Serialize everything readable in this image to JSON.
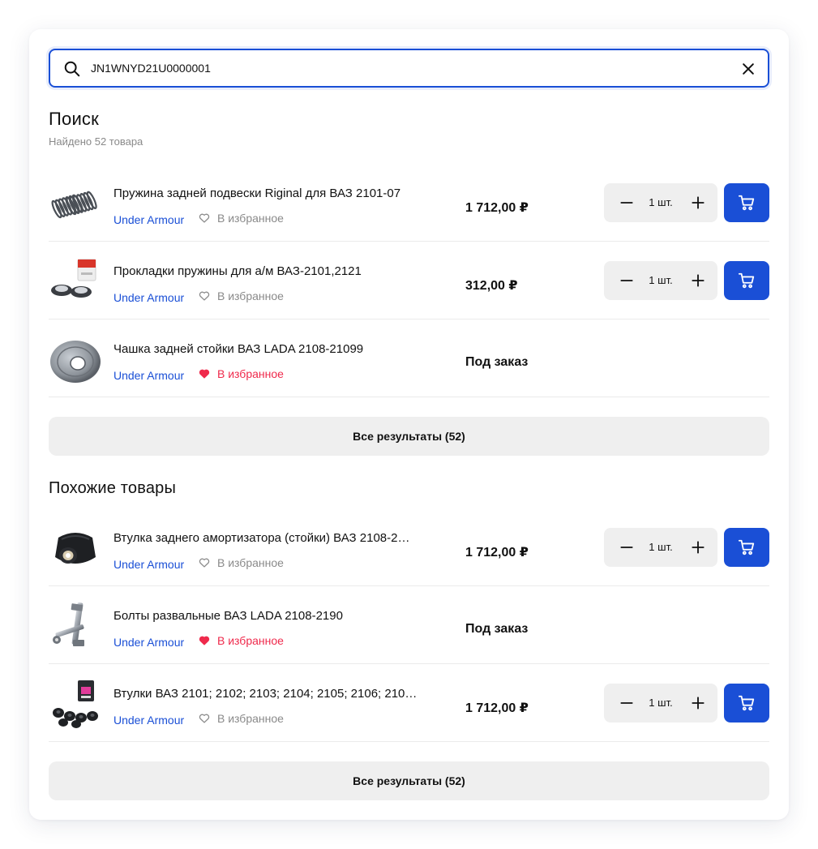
{
  "search": {
    "value": "JN1WNYD21U0000001"
  },
  "results": {
    "title": "Поиск",
    "subtitle": "Найдено 52 товара",
    "all_button": "Все результаты (52)",
    "items": [
      {
        "name": "Пружина задней подвески Riginal для ВАЗ 2101-07",
        "brand": "Under Armour",
        "fav": "В избранное",
        "fav_active": false,
        "price": "1 712,00 ₽",
        "qty": "1 шт.",
        "in_stock": true,
        "image": "spring"
      },
      {
        "name": "Прокладки пружины для а/м ВАЗ-2101,2121",
        "brand": "Under Armour",
        "fav": "В избранное",
        "fav_active": false,
        "price": "312,00 ₽",
        "qty": "1 шт.",
        "in_stock": true,
        "image": "spring-pads"
      },
      {
        "name": "Чашка задней стойки ВАЗ LADA 2108-21099",
        "brand": "Under Armour",
        "fav": "В избранное",
        "fav_active": true,
        "price": "Под заказ",
        "in_stock": false,
        "image": "strut-cup"
      }
    ]
  },
  "similar": {
    "title": "Похожие товары",
    "all_button": "Все результаты (52)",
    "items": [
      {
        "name": "Втулка заднего амортизатора (стойки) ВАЗ 2108-2…",
        "brand": "Under Armour",
        "fav": "В избранное",
        "fav_active": false,
        "price": "1 712,00 ₽",
        "qty": "1 шт.",
        "in_stock": true,
        "image": "bushing"
      },
      {
        "name": "Болты развальные ВАЗ LADA 2108-2190",
        "brand": "Under Armour",
        "fav": "В избранное",
        "fav_active": true,
        "price": "Под заказ",
        "in_stock": false,
        "image": "bolts"
      },
      {
        "name": "Втулки ВАЗ 2101; 2102; 2103; 2104; 2105; 2106; 210…",
        "brand": "Under Armour",
        "fav": "В избранное",
        "fav_active": false,
        "price": "1 712,00 ₽",
        "qty": "1 шт.",
        "in_stock": true,
        "image": "bushings-kit"
      }
    ]
  },
  "colors": {
    "accent": "#1a4fd6",
    "favorite_active": "#ef2a4c",
    "muted": "#8a8a8a",
    "button_bg": "#efefef"
  },
  "icons": {
    "search": "search-icon",
    "clear": "close-icon",
    "minus": "minus-icon",
    "plus": "plus-icon",
    "cart": "cart-icon",
    "heart": "heart-icon"
  }
}
